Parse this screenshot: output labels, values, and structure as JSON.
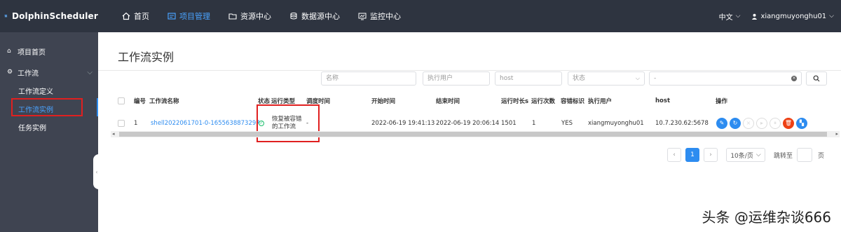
{
  "app": {
    "logo_text": "DolphinScheduler"
  },
  "nav": {
    "items": [
      {
        "label": "首页",
        "icon": "home-icon"
      },
      {
        "label": "项目管理",
        "icon": "project-icon",
        "active": true
      },
      {
        "label": "资源中心",
        "icon": "folder-icon"
      },
      {
        "label": "数据源中心",
        "icon": "database-icon"
      },
      {
        "label": "监控中心",
        "icon": "monitor-icon"
      }
    ],
    "language": "中文",
    "user": "xiangmuyonghu01"
  },
  "sidebar": {
    "home": "项目首页",
    "workflow": "工作流",
    "items": [
      {
        "label": "工作流定义"
      },
      {
        "label": "工作流实例",
        "active": true
      },
      {
        "label": "任务实例"
      }
    ]
  },
  "page": {
    "title": "工作流实例"
  },
  "filters": {
    "name_placeholder": "名称",
    "user_placeholder": "执行用户",
    "host_placeholder": "host",
    "state_placeholder": "状态",
    "date_value": "-"
  },
  "table": {
    "headers": {
      "no": "编号",
      "name": "工作流名称",
      "state": "状态",
      "run_type": "运行类型",
      "schedule_time": "调度时间",
      "start_time": "开始时间",
      "end_time": "结束时间",
      "duration": "运行时长s",
      "run_times": "运行次数",
      "fault_tolerant": "容错标识",
      "executor": "执行用户",
      "host": "host",
      "ops": "操作"
    },
    "rows": [
      {
        "no": "1",
        "name": "shell2022061701-0-1655638873297",
        "state": "success",
        "run_type": "恢复被容错的工作流",
        "schedule_time": "-",
        "start_time": "2022-06-19 19:41:13",
        "end_time": "2022-06-19 20:06:14",
        "duration": "1501",
        "run_times": "1",
        "fault_tolerant": "YES",
        "executor": "xiangmuyonghu01",
        "host": "10.7.230.62:5678"
      }
    ]
  },
  "pagination": {
    "current": "1",
    "page_size": "10条/页",
    "jump_label": "跳转至",
    "unit": "页"
  },
  "watermark": "头条 @运维杂谈666",
  "colors": {
    "accent": "#2d8cf0",
    "danger": "#ed4014",
    "success": "#19be6b",
    "topbar": "#2e3440",
    "sidebar": "#3f4451"
  }
}
